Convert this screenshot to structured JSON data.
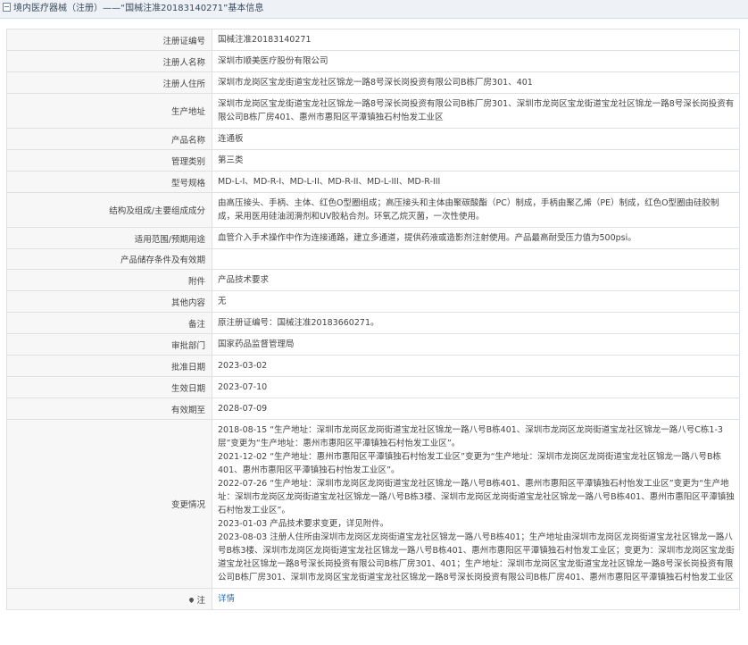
{
  "header": {
    "title": "境内医疗器械（注册）——“国械注准20183140271”基本信息"
  },
  "rows": [
    {
      "label": "注册证编号",
      "value": "国械注准20183140271"
    },
    {
      "label": "注册人名称",
      "value": "深圳市顺美医疗股份有限公司"
    },
    {
      "label": "注册人住所",
      "value": "深圳市龙岗区宝龙街道宝龙社区锦龙一路8号深长岗投资有限公司B栋厂房301、401"
    },
    {
      "label": "生产地址",
      "value": "深圳市龙岗区宝龙街道宝龙社区锦龙一路8号深长岗投资有限公司B栋厂房301、深圳市龙岗区宝龙街道宝龙社区锦龙一路8号深长岗投资有限公司B栋厂房401、惠州市惠阳区平潭镇独石村怡发工业区"
    },
    {
      "label": "产品名称",
      "value": "连通板"
    },
    {
      "label": "管理类别",
      "value": "第三类"
    },
    {
      "label": "型号规格",
      "value": "MD-L-I、MD-R-I、MD-L-II、MD-R-II、MD-L-III、MD-R-III"
    },
    {
      "label": "结构及组成/主要组成成分",
      "value": "由高压接头、手柄、主体、红色O型圈组成；高压接头和主体由聚碳酸酯（PC）制成，手柄由聚乙烯（PE）制成，红色O型圈由硅胶制成，采用医用硅油润滑剂和UV胶粘合剂。环氧乙烷灭菌，一次性使用。"
    },
    {
      "label": "适用范围/预期用途",
      "value": "血管介入手术操作中作为连接通路，建立多通道，提供药液或造影剂注射使用。产品最高耐受压力值为500psi。"
    },
    {
      "label": "产品储存条件及有效期",
      "value": ""
    },
    {
      "label": "附件",
      "value": "产品技术要求"
    },
    {
      "label": "其他内容",
      "value": "无"
    },
    {
      "label": "备注",
      "value": "原注册证编号：国械注准20183660271。"
    },
    {
      "label": "审批部门",
      "value": "国家药品监督管理局"
    },
    {
      "label": "批准日期",
      "value": "2023-03-02"
    },
    {
      "label": "生效日期",
      "value": "2023-07-10"
    },
    {
      "label": "有效期至",
      "value": "2028-07-09"
    }
  ],
  "changes": {
    "label": "变更情况",
    "items": [
      "2018-08-15 “生产地址：深圳市龙岗区龙岗街道宝龙社区锦龙一路八号B栋401、深圳市龙岗区龙岗街道宝龙社区锦龙一路八号C栋1-3层”变更为“生产地址：惠州市惠阳区平潭镇独石村怡发工业区”。",
      "2021-12-02 “生产地址：惠州市惠阳区平潭镇独石村怡发工业区”变更为“生产地址：深圳市龙岗区龙岗街道宝龙社区锦龙一路八号B栋401、惠州市惠阳区平潭镇独石村怡发工业区”。",
      "2022-07-26 “生产地址：深圳市龙岗区龙岗街道宝龙社区锦龙一路八号B栋401、惠州市惠阳区平潭镇独石村怡发工业区”变更为“生产地址：深圳市龙岗区龙岗街道宝龙社区锦龙一路八号B栋3楼、深圳市龙岗区龙岗街道宝龙社区锦龙一路八号B栋401、惠州市惠阳区平潭镇独石村怡发工业区”。",
      "2023-01-03 产品技术要求变更，详见附件。",
      "2023-08-03 注册人住所由深圳市龙岗区龙岗街道宝龙社区锦龙一路八号B栋401；生产地址由深圳市龙岗区龙岗街道宝龙社区锦龙一路八号B栋3楼、深圳市龙岗区龙岗街道宝龙社区锦龙一路八号B栋401、惠州市惠阳区平潭镇独石村怡发工业区；变更为：深圳市龙岗区宝龙街道宝龙社区锦龙一路8号深长岗投资有限公司B栋厂房301、401；生产地址：深圳市龙岗区宝龙街道宝龙社区锦龙一路8号深长岗投资有限公司B栋厂房301、深圳市龙岗区宝龙街道宝龙社区锦龙一路8号深长岗投资有限公司B栋厂房401、惠州市惠阳区平潭镇独石村怡发工业区"
    ]
  },
  "note": {
    "label": "注",
    "link_text": "详情",
    "icon": "pin-icon"
  },
  "colors": {
    "link": "#2a6fb5",
    "label_bg": "#f7f7f7",
    "border": "#dde1e6",
    "header_bg": "#eef2f7"
  }
}
